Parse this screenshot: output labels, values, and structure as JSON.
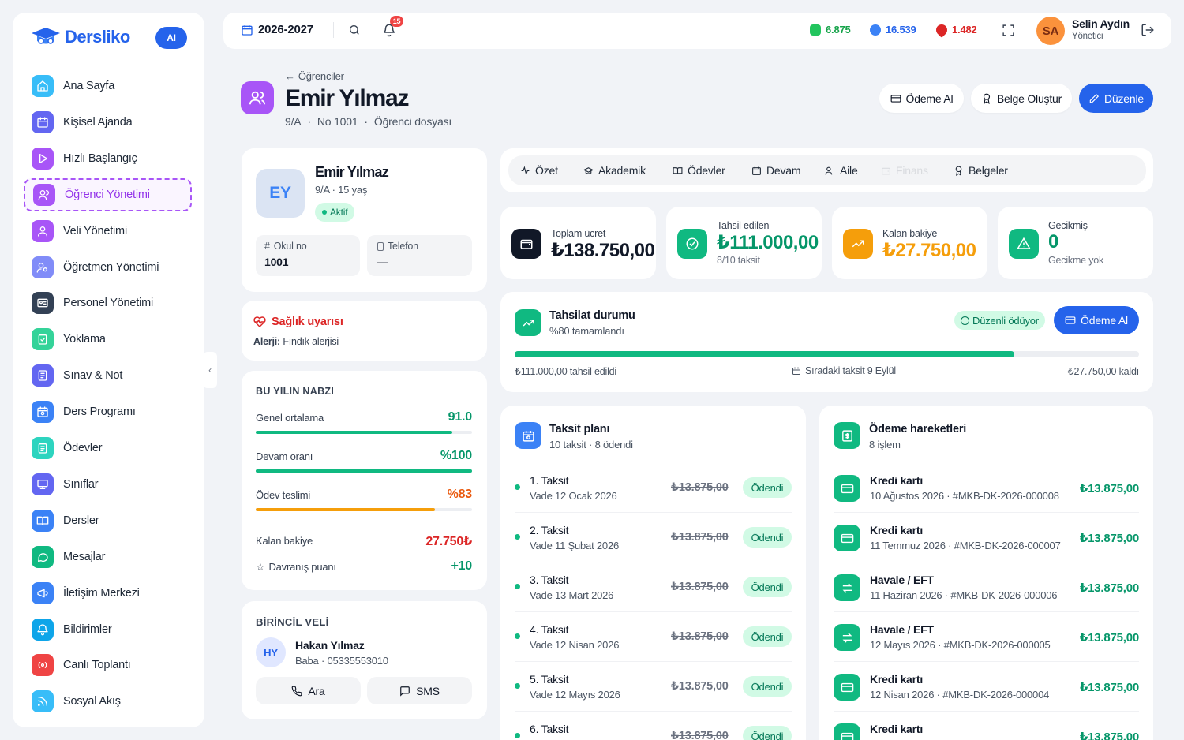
{
  "sidebar": {
    "brand": "Dersliko",
    "ai_badge": "AI",
    "items": [
      {
        "label": "Ana Sayfa",
        "color": "#38bdf8",
        "icon": "home-icon"
      },
      {
        "label": "Kişisel Ajanda",
        "color": "#6366f1",
        "icon": "calendar-icon"
      },
      {
        "label": "Hızlı Başlangıç",
        "color": "#a855f7",
        "icon": "play-icon"
      },
      {
        "label": "Öğrenci Yönetimi",
        "color": "#a855f7",
        "icon": "users-icon"
      },
      {
        "label": "Veli Yönetimi",
        "color": "#a855f7",
        "icon": "user-icon"
      },
      {
        "label": "Öğretmen Yönetimi",
        "color": "#818cf8",
        "icon": "teacher-icon"
      },
      {
        "label": "Personel Yönetimi",
        "color": "#334155",
        "icon": "id-card-icon"
      },
      {
        "label": "Yoklama",
        "color": "#34d399",
        "icon": "clipboard-check-icon"
      },
      {
        "label": "Sınav & Not",
        "color": "#6366f1",
        "icon": "exam-icon"
      },
      {
        "label": "Ders Programı",
        "color": "#3b82f6",
        "icon": "schedule-icon"
      },
      {
        "label": "Ödevler",
        "color": "#2dd4bf",
        "icon": "clipboard-icon"
      },
      {
        "label": "Sınıflar",
        "color": "#6366f1",
        "icon": "monitor-icon"
      },
      {
        "label": "Dersler",
        "color": "#3b82f6",
        "icon": "book-icon"
      },
      {
        "label": "Mesajlar",
        "color": "#10b981",
        "icon": "message-icon"
      },
      {
        "label": "İletişim Merkezi",
        "color": "#3b82f6",
        "icon": "megaphone-icon"
      },
      {
        "label": "Bildirimler",
        "color": "#0ea5e9",
        "icon": "bell-icon"
      },
      {
        "label": "Canlı Toplantı",
        "color": "#ef4444",
        "icon": "broadcast-icon"
      },
      {
        "label": "Sosyal Akış",
        "color": "#38bdf8",
        "icon": "rss-icon"
      }
    ]
  },
  "topbar": {
    "year": "2026-2027",
    "notif_count": "15",
    "stat1": "6.875",
    "stat2": "16.539",
    "stat3": "1.482",
    "user_initials": "SA",
    "user_name": "Selin Aydın",
    "user_role": "Yönetici"
  },
  "header": {
    "breadcrumb": "Öğrenciler",
    "title": "Emir Yılmaz",
    "class": "9/A",
    "number": "No 1001",
    "subtitle": "Öğrenci dosyası",
    "btn_payment": "Ödeme Al",
    "btn_document": "Belge Oluştur",
    "btn_edit": "Düzenle"
  },
  "profile": {
    "initials": "EY",
    "name": "Emir Yılmaz",
    "meta": "9/A · 15 yaş",
    "status": "Aktif",
    "school_no_label": "Okul no",
    "school_no": "1001",
    "phone_label": "Telefon",
    "phone": "—"
  },
  "health": {
    "title": "Sağlık uyarısı",
    "allergy_label": "Alerji:",
    "allergy": "Fındık alerjisi"
  },
  "pulse": {
    "title": "BU YILIN NABZI",
    "metrics": [
      {
        "label": "Genel ortalama",
        "value": "91.0",
        "fraction": 0.91,
        "color": "#10b981"
      },
      {
        "label": "Devam oranı",
        "value": "%100",
        "fraction": 1.0,
        "color": "#10b981"
      },
      {
        "label": "Ödev teslimi",
        "value": "%83",
        "fraction": 0.83,
        "color": "#f59e0b"
      }
    ],
    "balance_label": "Kalan bakiye",
    "balance": "27.750₺",
    "behavior_label": "Davranış puanı",
    "behavior": "+10"
  },
  "parent": {
    "title": "BİRİNCİL VELİ",
    "initials": "HY",
    "name": "Hakan Yılmaz",
    "meta": "Baba · 05335553010",
    "call": "Ara",
    "sms": "SMS"
  },
  "tabs": [
    {
      "label": "Özet",
      "icon": "activity-icon"
    },
    {
      "label": "Akademik",
      "icon": "graduation-icon"
    },
    {
      "label": "Ödevler",
      "icon": "book-open-icon"
    },
    {
      "label": "Devam",
      "icon": "calendar-icon"
    },
    {
      "label": "Aile",
      "icon": "users-icon"
    },
    {
      "label": "Finans",
      "icon": "wallet-icon"
    },
    {
      "label": "Belgeler",
      "icon": "award-icon"
    }
  ],
  "kpis": {
    "total_label": "Toplam ücret",
    "total": "₺138.750,00",
    "collected_label": "Tahsil edilen",
    "collected": "₺111.000,00",
    "collected_sub": "8/10 taksit",
    "remaining_label": "Kalan bakiye",
    "remaining": "₺27.750,00",
    "overdue_label": "Gecikmiş",
    "overdue": "0",
    "overdue_sub": "Gecikme yok"
  },
  "collection": {
    "title": "Tahsilat durumu",
    "subtitle": "%80 tamamlandı",
    "badge": "Düzenli ödüyor",
    "button": "Ödeme Al",
    "progress": 0.8,
    "left_text": "₺111.000,00 tahsil edildi",
    "mid_text": "Sıradaki taksit 9 Eylül",
    "right_text": "₺27.750,00 kaldı"
  },
  "installments": {
    "title": "Taksit planı",
    "subtitle": "10 taksit · 8 ödendi",
    "rows": [
      {
        "title": "1. Taksit",
        "due": "Vade 12 Ocak 2026",
        "amount": "₺13.875,00",
        "status": "Ödendi"
      },
      {
        "title": "2. Taksit",
        "due": "Vade 11 Şubat 2026",
        "amount": "₺13.875,00",
        "status": "Ödendi"
      },
      {
        "title": "3. Taksit",
        "due": "Vade 13 Mart 2026",
        "amount": "₺13.875,00",
        "status": "Ödendi"
      },
      {
        "title": "4. Taksit",
        "due": "Vade 12 Nisan 2026",
        "amount": "₺13.875,00",
        "status": "Ödendi"
      },
      {
        "title": "5. Taksit",
        "due": "Vade 12 Mayıs 2026",
        "amount": "₺13.875,00",
        "status": "Ödendi"
      },
      {
        "title": "6. Taksit",
        "due": "",
        "amount": "₺13.875,00",
        "status": "Ödendi"
      }
    ]
  },
  "payments": {
    "title": "Ödeme hareketleri",
    "subtitle": "8 işlem",
    "rows": [
      {
        "title": "Kredi kartı",
        "sub": "10 Ağustos 2026 · #MKB-DK-2026-000008",
        "amount": "₺13.875,00",
        "icon": "card-icon"
      },
      {
        "title": "Kredi kartı",
        "sub": "11 Temmuz 2026 · #MKB-DK-2026-000007",
        "amount": "₺13.875,00",
        "icon": "card-icon"
      },
      {
        "title": "Havale / EFT",
        "sub": "11 Haziran 2026 · #MKB-DK-2026-000006",
        "amount": "₺13.875,00",
        "icon": "transfer-icon"
      },
      {
        "title": "Havale / EFT",
        "sub": "12 Mayıs 2026 · #MKB-DK-2026-000005",
        "amount": "₺13.875,00",
        "icon": "transfer-icon"
      },
      {
        "title": "Kredi kartı",
        "sub": "12 Nisan 2026 · #MKB-DK-2026-000004",
        "amount": "₺13.875,00",
        "icon": "card-icon"
      },
      {
        "title": "Kredi kartı",
        "sub": "",
        "amount": "₺13.875,00",
        "icon": "card-icon"
      }
    ]
  }
}
